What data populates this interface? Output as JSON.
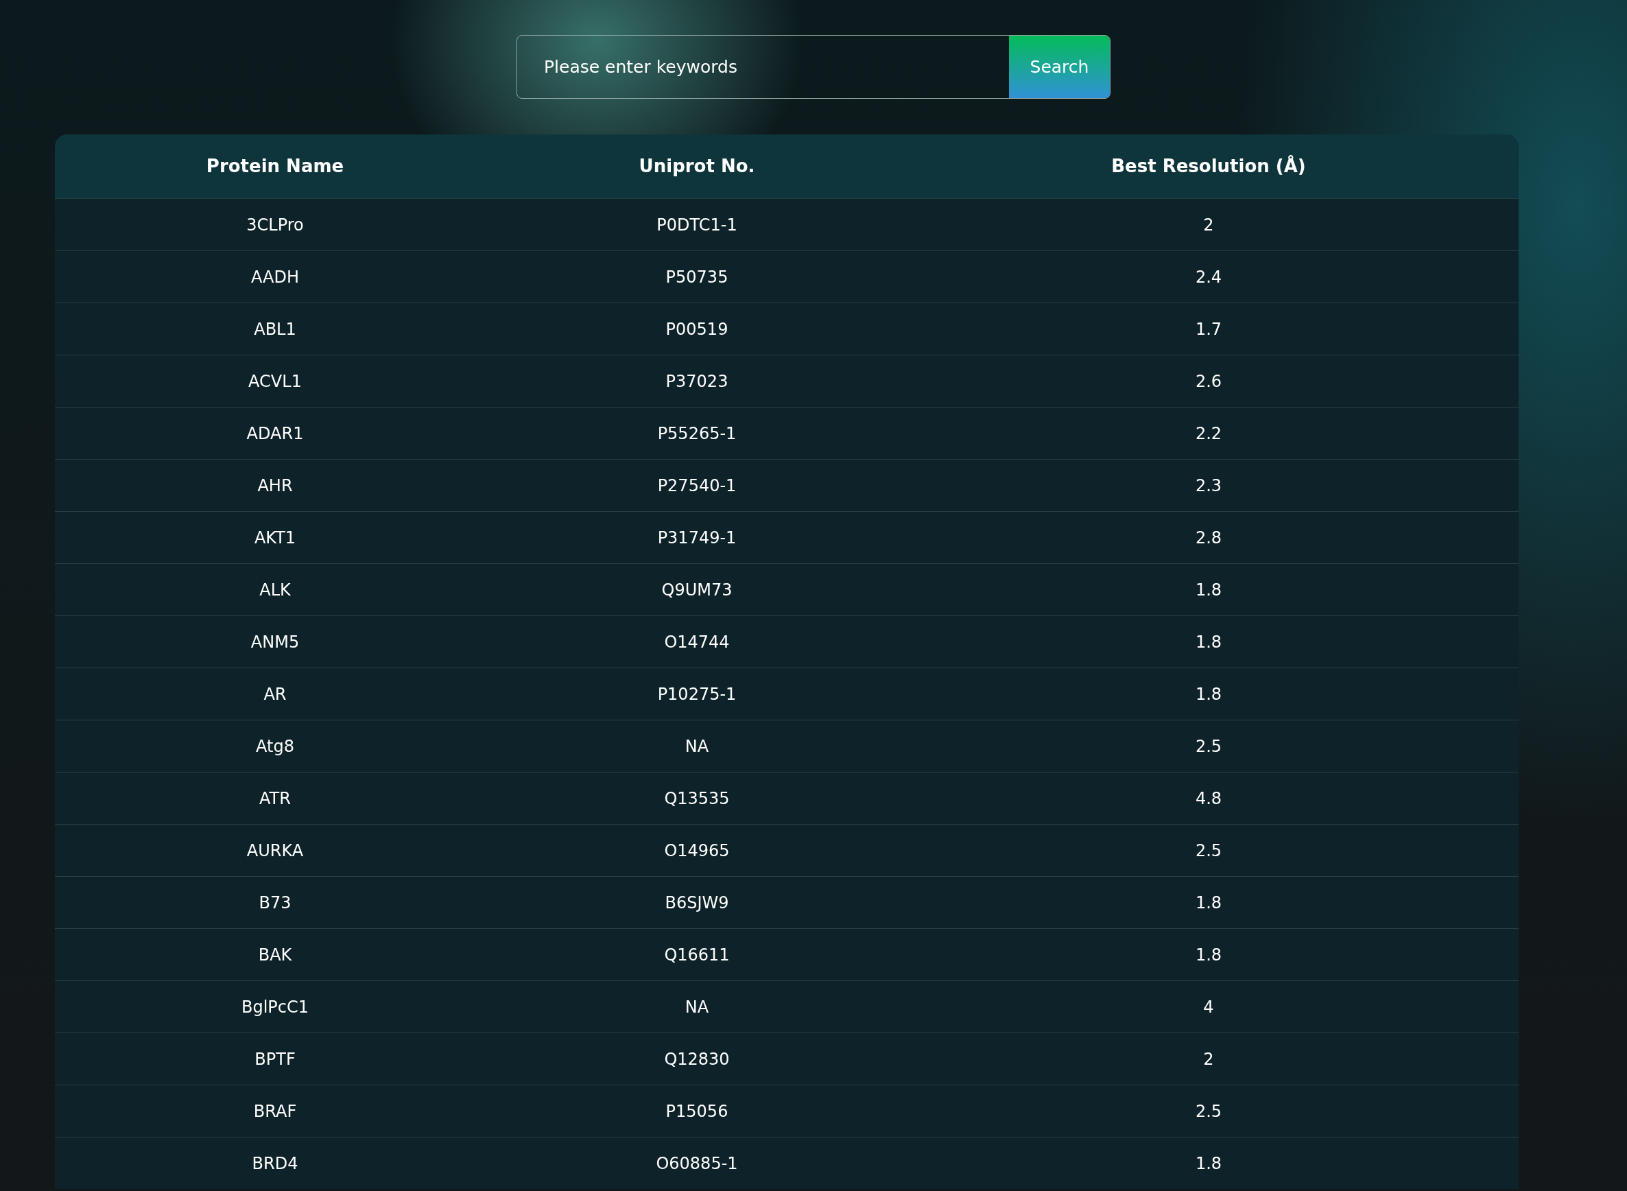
{
  "search": {
    "placeholder": "Please enter keywords",
    "button": "Search"
  },
  "table": {
    "columns": [
      "Protein Name",
      "Uniprot No.",
      "Best Resolution (Å)"
    ],
    "rows": [
      [
        "3CLPro",
        "P0DTC1-1",
        "2"
      ],
      [
        "AADH",
        "P50735",
        "2.4"
      ],
      [
        "ABL1",
        "P00519",
        "1.7"
      ],
      [
        "ACVL1",
        "P37023",
        "2.6"
      ],
      [
        "ADAR1",
        "P55265-1",
        "2.2"
      ],
      [
        "AHR",
        "P27540-1",
        "2.3"
      ],
      [
        "AKT1",
        "P31749-1",
        "2.8"
      ],
      [
        "ALK",
        "Q9UM73",
        "1.8"
      ],
      [
        "ANM5",
        "O14744",
        "1.8"
      ],
      [
        "AR",
        "P10275-1",
        "1.8"
      ],
      [
        "Atg8",
        "NA",
        "2.5"
      ],
      [
        "ATR",
        "Q13535",
        "4.8"
      ],
      [
        "AURKA",
        "O14965",
        "2.5"
      ],
      [
        "B73",
        "B6SJW9",
        "1.8"
      ],
      [
        "BAK",
        "Q16611",
        "1.8"
      ],
      [
        "BglPcC1",
        "NA",
        "4"
      ],
      [
        "BPTF",
        "Q12830",
        "2"
      ],
      [
        "BRAF",
        "P15056",
        "2.5"
      ],
      [
        "BRD4",
        "O60885-1",
        "1.8"
      ]
    ]
  }
}
